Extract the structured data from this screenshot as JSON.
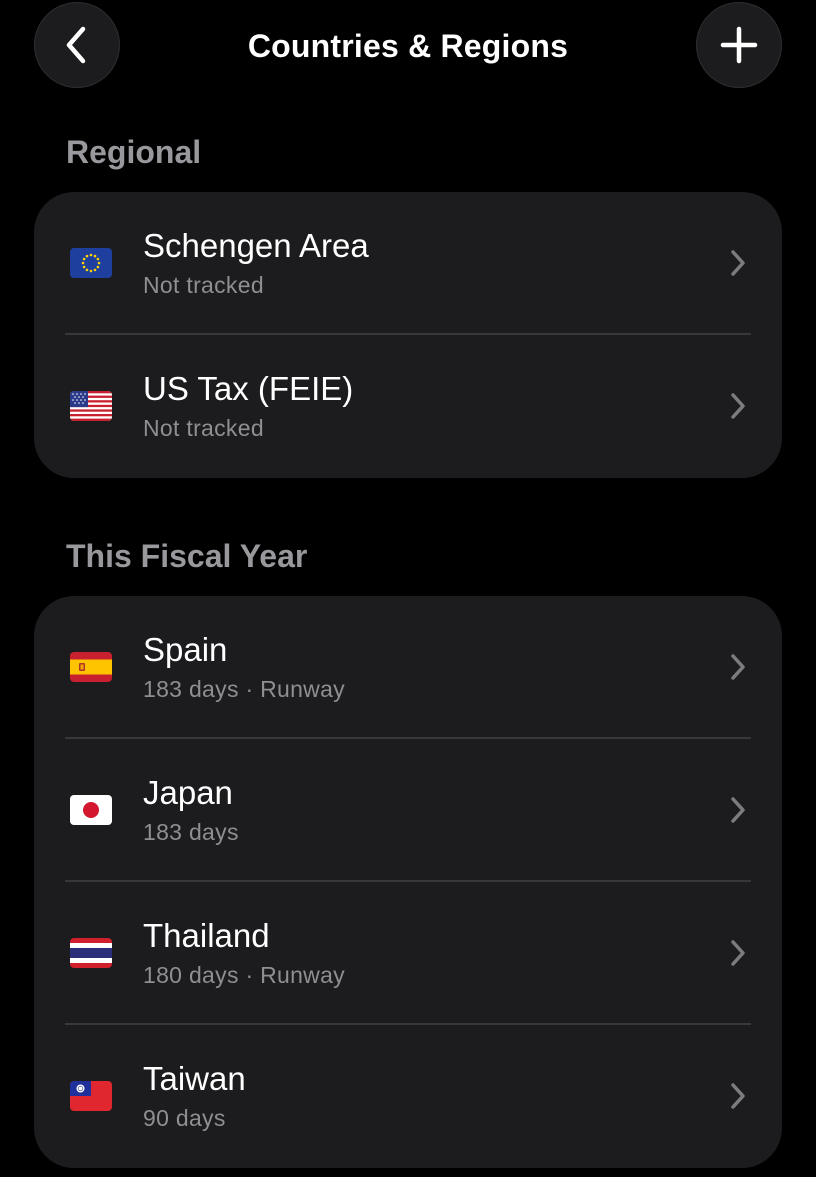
{
  "header": {
    "title": "Countries & Regions",
    "back_icon": "chevron-left-icon",
    "add_icon": "plus-icon"
  },
  "sections": [
    {
      "title": "Regional",
      "items": [
        {
          "flag": "eu-flag-icon",
          "name": "Schengen Area",
          "subtitle": "Not tracked"
        },
        {
          "flag": "us-flag-icon",
          "name": "US Tax (FEIE)",
          "subtitle": "Not tracked"
        }
      ]
    },
    {
      "title": "This Fiscal Year",
      "items": [
        {
          "flag": "spain-flag-icon",
          "name": "Spain",
          "subtitle": "183 days · Runway"
        },
        {
          "flag": "japan-flag-icon",
          "name": "Japan",
          "subtitle": "183 days"
        },
        {
          "flag": "thailand-flag-icon",
          "name": "Thailand",
          "subtitle": "180 days · Runway"
        },
        {
          "flag": "taiwan-flag-icon",
          "name": "Taiwan",
          "subtitle": "90 days"
        }
      ]
    }
  ],
  "colors": {
    "background": "#000000",
    "card": "#1c1c1e",
    "section_title": "#98989d",
    "subtitle": "#8e8e93",
    "chevron": "#7c7c80"
  }
}
